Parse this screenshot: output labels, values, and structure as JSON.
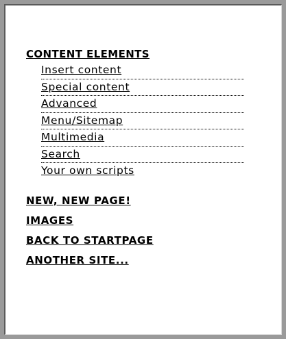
{
  "menu": {
    "section_title": "CONTENT ELEMENTS",
    "sub_items": [
      {
        "label": "Insert content"
      },
      {
        "label": "Special content"
      },
      {
        "label": "Advanced"
      },
      {
        "label": "Menu/Sitemap"
      },
      {
        "label": "Multimedia"
      },
      {
        "label": "Search"
      },
      {
        "label": "Your own scripts"
      }
    ],
    "links": [
      {
        "label": "NEW, NEW PAGE!"
      },
      {
        "label": "IMAGES"
      },
      {
        "label": "BACK TO STARTPAGE"
      },
      {
        "label": "ANOTHER SITE..."
      }
    ]
  }
}
